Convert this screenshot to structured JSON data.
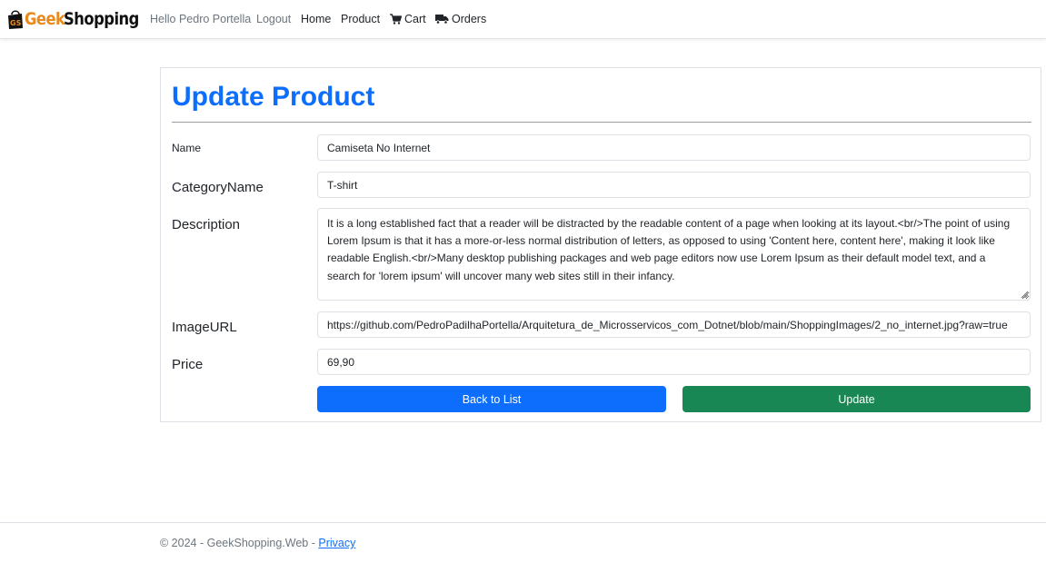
{
  "navbar": {
    "brand": {
      "part1": "Geek",
      "part2": "Shopping",
      "logo_icon": "shopping-bag-logo-icon"
    },
    "greeting": "Hello Pedro Portella",
    "logout": "Logout",
    "home": "Home",
    "product": "Product",
    "cart": {
      "label": "Cart",
      "icon": "cart-icon"
    },
    "orders": {
      "label": "Orders",
      "icon": "truck-icon"
    }
  },
  "form": {
    "title": "Update Product",
    "fields": {
      "name": {
        "label": "Name",
        "value": "Camiseta No Internet"
      },
      "category": {
        "label": "CategoryName",
        "value": "T-shirt"
      },
      "description": {
        "label": "Description",
        "value": "It is a long established fact that a reader will be distracted by the readable content of a page when looking at its layout.<br/>The point of using Lorem Ipsum is that it has a more-or-less normal distribution of letters, as opposed to using 'Content here, content here', making it look like readable English.<br/>Many desktop publishing packages and web page editors now use Lorem Ipsum as their default model text, and a search for 'lorem ipsum' will uncover many web sites still in their infancy."
      },
      "image_url": {
        "label": "ImageURL",
        "value": "https://github.com/PedroPadilhaPortella/Arquitetura_de_Microsservicos_com_Dotnet/blob/main/ShoppingImages/2_no_internet.jpg?raw=true"
      },
      "price": {
        "label": "Price",
        "value": "69,90"
      }
    },
    "buttons": {
      "back": "Back to List",
      "update": "Update"
    }
  },
  "footer": {
    "text": "© 2024 - GeekShopping.Web - ",
    "privacy": "Privacy"
  },
  "colors": {
    "primary": "#0d6efd",
    "success": "#198754",
    "brand_orange": "#e98a1e"
  }
}
